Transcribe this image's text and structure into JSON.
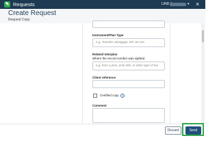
{
  "topbar": {
    "app_title": "Requests",
    "logo_glyph": "✎",
    "user_name": "LIND A",
    "user_caret": "▾",
    "close_glyph": "×",
    "background": "#1d3a52",
    "logo_color": "#2fa84f"
  },
  "dialog": {
    "title": "Create Request",
    "subtitle": "Request Copy"
  },
  "form": {
    "top_input_value": "",
    "instrument_label": "Instrument/Plan Type",
    "instrument_placeholder": "e.g. Transfer, Mortgage, DP, SO etc.",
    "related_label": "Related Interplan",
    "related_sublabel": "Where the record number was sighted",
    "related_placeholder": "e.g. from a plan, prior title, or other type of lea",
    "client_ref_label": "Client reference",
    "client_ref_value": "",
    "certified_copy_label": "Certified copy",
    "certified_copy_checked": false,
    "info_glyph": "i",
    "comment_label": "Comment",
    "comment_value": ""
  },
  "footer": {
    "discard_label": "Discard",
    "send_label": "Send",
    "send_color": "#1f4f7a",
    "highlight_color": "#2fa84f"
  }
}
